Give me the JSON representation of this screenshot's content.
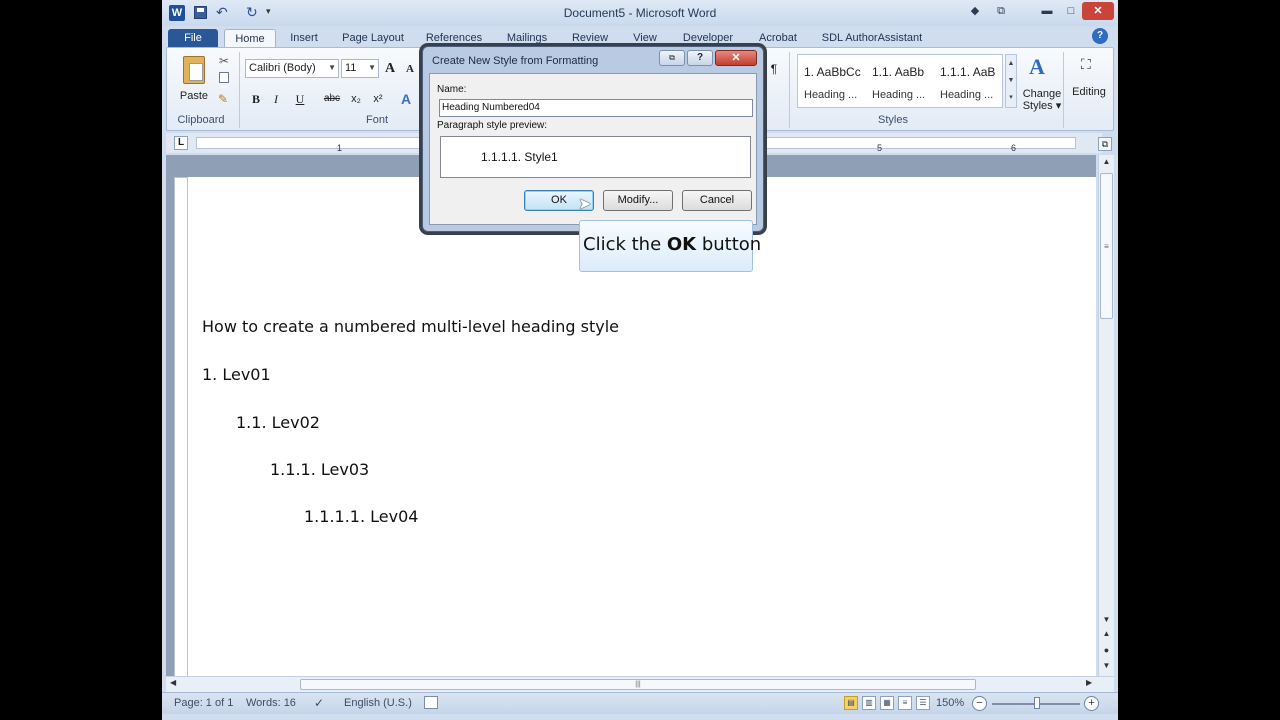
{
  "window": {
    "title": "Document5 - Microsoft Word"
  },
  "qat": {
    "undo_icon": "↶",
    "redo_icon": "↻",
    "more_icon": "▾"
  },
  "window_controls": {
    "minimize": "▬",
    "maximize": "□",
    "close": "✕",
    "help_icon": "◆",
    "restore_icon": "⧉"
  },
  "tabs": [
    {
      "label": "File"
    },
    {
      "label": "Home"
    },
    {
      "label": "Insert"
    },
    {
      "label": "Page Layout"
    },
    {
      "label": "References"
    },
    {
      "label": "Mailings"
    },
    {
      "label": "Review"
    },
    {
      "label": "View"
    },
    {
      "label": "Developer"
    },
    {
      "label": "Acrobat"
    },
    {
      "label": "SDL AuthorAssistant"
    }
  ],
  "ribbon": {
    "clipboard": {
      "paste_label": "Paste",
      "group_label": "Clipboard"
    },
    "font": {
      "name": "Calibri (Body)",
      "size": "11",
      "group_label": "Font",
      "bold": "B",
      "italic": "I",
      "underline": "U",
      "strike": "abc",
      "subscript": "x₂",
      "superscript": "x²",
      "grow": "A",
      "shrink": "A",
      "effects": "A"
    },
    "paragraph": {
      "pilcrow": "¶"
    },
    "styles": {
      "group_label": "Styles",
      "gallery": [
        {
          "sample": "1. AaBbCc",
          "name": "Heading ..."
        },
        {
          "sample": "1.1. AaBb",
          "name": "Heading ..."
        },
        {
          "sample": "1.1.1. AaB",
          "name": "Heading ..."
        }
      ],
      "change_styles_label": "Change Styles ▾"
    },
    "editing": {
      "label": "Editing",
      "icon": "⛶"
    }
  },
  "ruler": {
    "tab_selector": "L",
    "numbers": [
      "1",
      "5",
      "6"
    ]
  },
  "document": {
    "heading": "How to create a numbered multi-level heading style",
    "levels": [
      "1. Lev01",
      "1.1.  Lev02",
      "1.1.1. Lev03",
      "1.1.1.1. Lev04"
    ]
  },
  "dialog": {
    "title": "Create New Style from Formatting",
    "help": "?",
    "close": "✕",
    "name_label": "Name:",
    "name_value": "Heading Numbered04",
    "preview_label": "Paragraph style preview:",
    "preview_text": "1.1.1.1.  Style1",
    "ok_label": "OK",
    "modify_label": "Modify...",
    "cancel_label": "Cancel"
  },
  "callout": {
    "prefix": "Click the ",
    "bold": "OK",
    "suffix": " button"
  },
  "statusbar": {
    "page": "Page: 1 of 1",
    "words": "Words: 16",
    "language": "English (U.S.)",
    "zoom": "150%",
    "zoom_minus": "−",
    "zoom_plus": "+"
  }
}
